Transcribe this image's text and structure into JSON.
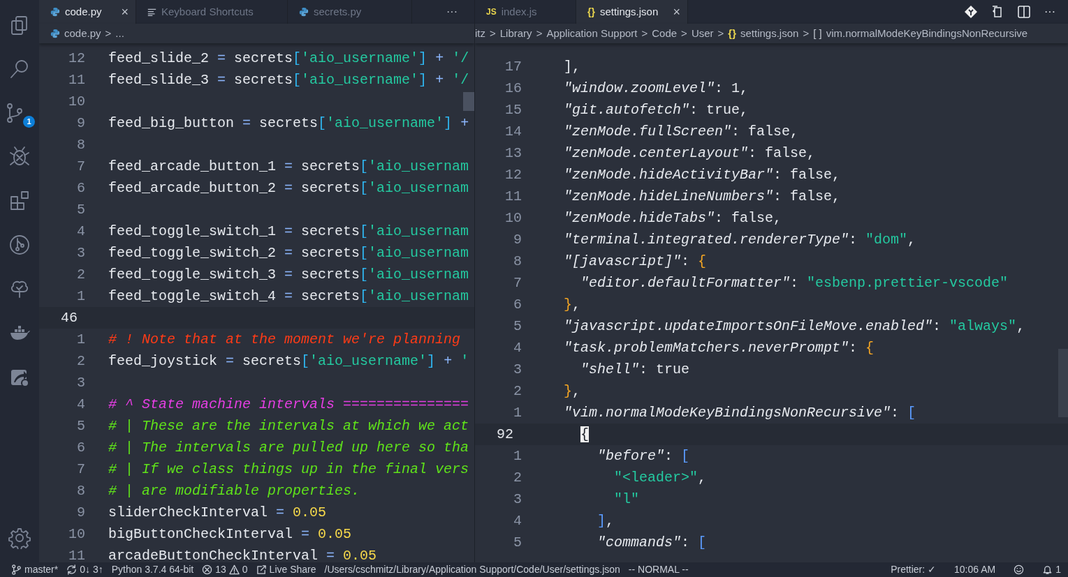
{
  "activity_bar": {
    "source_control_badge": "1"
  },
  "left_group": {
    "tabs": [
      {
        "kind": "python",
        "label": "code.py",
        "selected": true,
        "close": "×"
      },
      {
        "kind": "lines",
        "label": "Keyboard Shortcuts",
        "selected": false
      },
      {
        "kind": "python",
        "label": "secrets.py",
        "selected": false
      }
    ],
    "actions": [
      "···"
    ],
    "breadcrumbs": [
      {
        "kind": "python",
        "label": "code.py"
      },
      {
        "separator": ">",
        "label": "..."
      }
    ],
    "lines": [
      {
        "num": "12",
        "current": false,
        "code": [
          {
            "text": "feed_slide_2 ",
            "kind": "plain"
          },
          {
            "text": "= ",
            "kind": "op"
          },
          {
            "text": "secrets",
            "kind": "plain"
          },
          {
            "text": "[",
            "kind": "bracket"
          },
          {
            "text": "'aio_username'",
            "kind": "str"
          },
          {
            "text": "] ",
            "kind": "bracket"
          },
          {
            "text": "+ ",
            "kind": "op"
          },
          {
            "text": "'/",
            "kind": "str"
          }
        ]
      },
      {
        "num": "11",
        "current": false,
        "code": [
          {
            "text": "feed_slide_3 ",
            "kind": "plain"
          },
          {
            "text": "= ",
            "kind": "op"
          },
          {
            "text": "secrets",
            "kind": "plain"
          },
          {
            "text": "[",
            "kind": "bracket"
          },
          {
            "text": "'aio_username'",
            "kind": "str"
          },
          {
            "text": "] ",
            "kind": "bracket"
          },
          {
            "text": "+ ",
            "kind": "op"
          },
          {
            "text": "'/",
            "kind": "str"
          }
        ]
      },
      {
        "num": "10",
        "current": false
      },
      {
        "num": "9",
        "current": false,
        "code": [
          {
            "text": "feed_big_button ",
            "kind": "plain"
          },
          {
            "text": "= ",
            "kind": "op"
          },
          {
            "text": "secrets",
            "kind": "plain"
          },
          {
            "text": "[",
            "kind": "bracket"
          },
          {
            "text": "'aio_username'",
            "kind": "str"
          },
          {
            "text": "] ",
            "kind": "bracket"
          },
          {
            "text": "+",
            "kind": "op"
          }
        ]
      },
      {
        "num": "8",
        "current": false
      },
      {
        "num": "7",
        "current": false,
        "code": [
          {
            "text": "feed_arcade_button_1 ",
            "kind": "plain"
          },
          {
            "text": "= ",
            "kind": "op"
          },
          {
            "text": "secrets",
            "kind": "plain"
          },
          {
            "text": "[",
            "kind": "bracket"
          },
          {
            "text": "'aio_usernam",
            "kind": "str"
          }
        ]
      },
      {
        "num": "6",
        "current": false,
        "code": [
          {
            "text": "feed_arcade_button_2 ",
            "kind": "plain"
          },
          {
            "text": "= ",
            "kind": "op"
          },
          {
            "text": "secrets",
            "kind": "plain"
          },
          {
            "text": "[",
            "kind": "bracket"
          },
          {
            "text": "'aio_usernam",
            "kind": "str"
          }
        ]
      },
      {
        "num": "5",
        "current": false
      },
      {
        "num": "4",
        "current": false,
        "code": [
          {
            "text": "feed_toggle_switch_1 ",
            "kind": "plain"
          },
          {
            "text": "= ",
            "kind": "op"
          },
          {
            "text": "secrets",
            "kind": "plain"
          },
          {
            "text": "[",
            "kind": "bracket"
          },
          {
            "text": "'aio_usernam",
            "kind": "str"
          }
        ]
      },
      {
        "num": "3",
        "current": false,
        "code": [
          {
            "text": "feed_toggle_switch_2 ",
            "kind": "plain"
          },
          {
            "text": "= ",
            "kind": "op"
          },
          {
            "text": "secrets",
            "kind": "plain"
          },
          {
            "text": "[",
            "kind": "bracket"
          },
          {
            "text": "'aio_usernam",
            "kind": "str"
          }
        ]
      },
      {
        "num": "2",
        "current": false,
        "code": [
          {
            "text": "feed_toggle_switch_3 ",
            "kind": "plain"
          },
          {
            "text": "= ",
            "kind": "op"
          },
          {
            "text": "secrets",
            "kind": "plain"
          },
          {
            "text": "[",
            "kind": "bracket"
          },
          {
            "text": "'aio_usernam",
            "kind": "str"
          }
        ]
      },
      {
        "num": "1",
        "current": false,
        "code": [
          {
            "text": "feed_toggle_switch_4 ",
            "kind": "plain"
          },
          {
            "text": "= ",
            "kind": "op"
          },
          {
            "text": "secrets",
            "kind": "plain"
          },
          {
            "text": "[",
            "kind": "bracket"
          },
          {
            "text": "'aio_usernam",
            "kind": "str"
          }
        ]
      },
      {
        "num": "46",
        "current": true
      },
      {
        "num": "1",
        "current": false,
        "code": [
          {
            "text": "# ! Note that at the moment we're planning",
            "kind": "comment-red"
          }
        ]
      },
      {
        "num": "2",
        "current": false,
        "code": [
          {
            "text": "feed_joystick ",
            "kind": "plain"
          },
          {
            "text": "= ",
            "kind": "op"
          },
          {
            "text": "secrets",
            "kind": "plain"
          },
          {
            "text": "[",
            "kind": "bracket"
          },
          {
            "text": "'aio_username'",
            "kind": "str"
          },
          {
            "text": "] ",
            "kind": "bracket"
          },
          {
            "text": "+ ",
            "kind": "op"
          },
          {
            "text": "'",
            "kind": "str"
          }
        ]
      },
      {
        "num": "3",
        "current": false
      },
      {
        "num": "4",
        "current": false,
        "code": [
          {
            "text": "# ^ State machine intervals ===============",
            "kind": "comment-pink"
          }
        ]
      },
      {
        "num": "5",
        "current": false,
        "code": [
          {
            "text": "# | These are the intervals at which we act",
            "kind": "comment-green"
          }
        ]
      },
      {
        "num": "6",
        "current": false,
        "code": [
          {
            "text": "# | The intervals are pulled up here so tha",
            "kind": "comment-green"
          }
        ]
      },
      {
        "num": "7",
        "current": false,
        "code": [
          {
            "text": "# | If we class things up in the final vers",
            "kind": "comment-green"
          }
        ]
      },
      {
        "num": "8",
        "current": false,
        "code": [
          {
            "text": "# | are modifiable properties.",
            "kind": "comment-green"
          }
        ]
      },
      {
        "num": "9",
        "current": false,
        "code": [
          {
            "text": "sliderCheckInterval ",
            "kind": "plain"
          },
          {
            "text": "= ",
            "kind": "op"
          },
          {
            "text": "0.05",
            "kind": "num"
          }
        ]
      },
      {
        "num": "10",
        "current": false,
        "code": [
          {
            "text": "bigButtonCheckInterval ",
            "kind": "plain"
          },
          {
            "text": "= ",
            "kind": "op"
          },
          {
            "text": "0.05",
            "kind": "num"
          }
        ]
      },
      {
        "num": "11",
        "current": false,
        "code": [
          {
            "text": "arcadeButtonCheckInterval ",
            "kind": "plain"
          },
          {
            "text": "= ",
            "kind": "op"
          },
          {
            "text": "0.05",
            "kind": "num"
          }
        ]
      }
    ]
  },
  "right_group": {
    "tabs": [
      {
        "kind": "js",
        "icon_text": "JS",
        "label": "index.js",
        "selected": false
      },
      {
        "kind": "json",
        "icon_text": "{}",
        "label": "settings.json",
        "selected": true,
        "close": "×"
      }
    ],
    "actions": [
      "···"
    ],
    "breadcrumbs": [
      {
        "label": "itz"
      },
      {
        "separator": ">",
        "label": "Library"
      },
      {
        "separator": ">",
        "label": "Application Support"
      },
      {
        "separator": ">",
        "label": "Code"
      },
      {
        "separator": ">",
        "label": "User"
      },
      {
        "separator": ">",
        "icon_text": "{}",
        "label": "settings.json"
      },
      {
        "separator": ">",
        "icon_text": "[ ]",
        "label": "vim.normalModeKeyBindingsNonRecursive"
      }
    ],
    "lines": [
      {
        "num": "17",
        "current": false,
        "code": [
          {
            "text": "],",
            "kind": "plain"
          }
        ]
      },
      {
        "num": "16",
        "current": false,
        "code": [
          {
            "text": "\"window.zoomLevel\"",
            "kind": "key"
          },
          {
            "text": ": 1,",
            "kind": "plain"
          }
        ]
      },
      {
        "num": "15",
        "current": false,
        "code": [
          {
            "text": "\"git.autofetch\"",
            "kind": "key"
          },
          {
            "text": ": true,",
            "kind": "plain"
          }
        ]
      },
      {
        "num": "14",
        "current": false,
        "code": [
          {
            "text": "\"zenMode.fullScreen\"",
            "kind": "key"
          },
          {
            "text": ": false,",
            "kind": "plain"
          }
        ]
      },
      {
        "num": "13",
        "current": false,
        "code": [
          {
            "text": "\"zenMode.centerLayout\"",
            "kind": "key"
          },
          {
            "text": ": false,",
            "kind": "plain"
          }
        ]
      },
      {
        "num": "12",
        "current": false,
        "code": [
          {
            "text": "\"zenMode.hideActivityBar\"",
            "kind": "key"
          },
          {
            "text": ": false,",
            "kind": "plain"
          }
        ]
      },
      {
        "num": "11",
        "current": false,
        "code": [
          {
            "text": "\"zenMode.hideLineNumbers\"",
            "kind": "key"
          },
          {
            "text": ": false,",
            "kind": "plain"
          }
        ]
      },
      {
        "num": "10",
        "current": false,
        "code": [
          {
            "text": "\"zenMode.hideTabs\"",
            "kind": "key"
          },
          {
            "text": ": false,",
            "kind": "plain"
          }
        ]
      },
      {
        "num": "9",
        "current": false,
        "code": [
          {
            "text": "\"terminal.integrated.rendererType\"",
            "kind": "key"
          },
          {
            "text": ": ",
            "kind": "plain"
          },
          {
            "text": "\"dom\"",
            "kind": "str"
          },
          {
            "text": ",",
            "kind": "plain"
          }
        ]
      },
      {
        "num": "8",
        "current": false,
        "code": [
          {
            "text": "\"[javascript]\"",
            "kind": "key"
          },
          {
            "text": ": ",
            "kind": "plain"
          },
          {
            "text": "{",
            "kind": "brace"
          }
        ]
      },
      {
        "num": "7",
        "current": false,
        "code": [
          {
            "text": "  \"editor.defaultFormatter\"",
            "kind": "key"
          },
          {
            "text": ": ",
            "kind": "plain"
          },
          {
            "text": "\"esbenp.prettier-vscode\"",
            "kind": "str"
          }
        ]
      },
      {
        "num": "6",
        "current": false,
        "code": [
          {
            "text": "}",
            "kind": "brace"
          },
          {
            "text": ",",
            "kind": "plain"
          }
        ]
      },
      {
        "num": "5",
        "current": false,
        "code": [
          {
            "text": "\"javascript.updateImportsOnFileMove.enabled\"",
            "kind": "key"
          },
          {
            "text": ": ",
            "kind": "plain"
          },
          {
            "text": "\"always\"",
            "kind": "str"
          },
          {
            "text": ",",
            "kind": "plain"
          }
        ]
      },
      {
        "num": "4",
        "current": false,
        "code": [
          {
            "text": "\"task.problemMatchers.neverPrompt\"",
            "kind": "key"
          },
          {
            "text": ": ",
            "kind": "plain"
          },
          {
            "text": "{",
            "kind": "brace"
          }
        ]
      },
      {
        "num": "3",
        "current": false,
        "code": [
          {
            "text": "  \"shell\"",
            "kind": "key"
          },
          {
            "text": ": true",
            "kind": "plain"
          }
        ]
      },
      {
        "num": "2",
        "current": false,
        "code": [
          {
            "text": "}",
            "kind": "brace"
          },
          {
            "text": ",",
            "kind": "plain"
          }
        ]
      },
      {
        "num": "1",
        "current": false,
        "code": [
          {
            "text": "\"vim.normalModeKeyBindingsNonRecursive\"",
            "kind": "key"
          },
          {
            "text": ": ",
            "kind": "plain"
          },
          {
            "text": "[",
            "kind": "square"
          }
        ]
      },
      {
        "num": "92",
        "current": true,
        "code": [
          {
            "text": "  {",
            "kind": "cursor"
          }
        ]
      },
      {
        "num": "1",
        "current": false,
        "code": [
          {
            "text": "    \"before\"",
            "kind": "key"
          },
          {
            "text": ": ",
            "kind": "plain"
          },
          {
            "text": "[",
            "kind": "square"
          }
        ]
      },
      {
        "num": "2",
        "current": false,
        "code": [
          {
            "text": "      \"<leader>\"",
            "kind": "str"
          },
          {
            "text": ",",
            "kind": "plain"
          }
        ]
      },
      {
        "num": "3",
        "current": false,
        "code": [
          {
            "text": "      \"l\"",
            "kind": "str"
          }
        ]
      },
      {
        "num": "4",
        "current": false,
        "code": [
          {
            "text": "    ]",
            "kind": "square"
          },
          {
            "text": ",",
            "kind": "plain"
          }
        ]
      },
      {
        "num": "5",
        "current": false,
        "code": [
          {
            "text": "    \"commands\"",
            "kind": "key"
          },
          {
            "text": ": ",
            "kind": "plain"
          },
          {
            "text": "[",
            "kind": "square"
          }
        ]
      }
    ]
  },
  "status_bar": {
    "left": [
      {
        "kind": "branch",
        "text": "master*"
      },
      {
        "kind": "sync",
        "text": "0↓ 3↑"
      },
      {
        "kind": "text",
        "text": "Python 3.7.4 64-bit"
      },
      {
        "kind": "error",
        "text": "13"
      },
      {
        "kind": "warning",
        "text": "0"
      },
      {
        "kind": "live-share",
        "text": "Live Share"
      },
      {
        "kind": "text",
        "text": "/Users/cschmitz/Library/Application Support/Code/User/settings.json"
      },
      {
        "kind": "text",
        "text": "-- NORMAL --"
      }
    ],
    "right": [
      {
        "kind": "text",
        "text": "Prettier: ✓"
      },
      {
        "kind": "text",
        "text": "10:06 AM"
      },
      {
        "kind": "smiley"
      },
      {
        "kind": "bell",
        "text": "1"
      }
    ]
  }
}
